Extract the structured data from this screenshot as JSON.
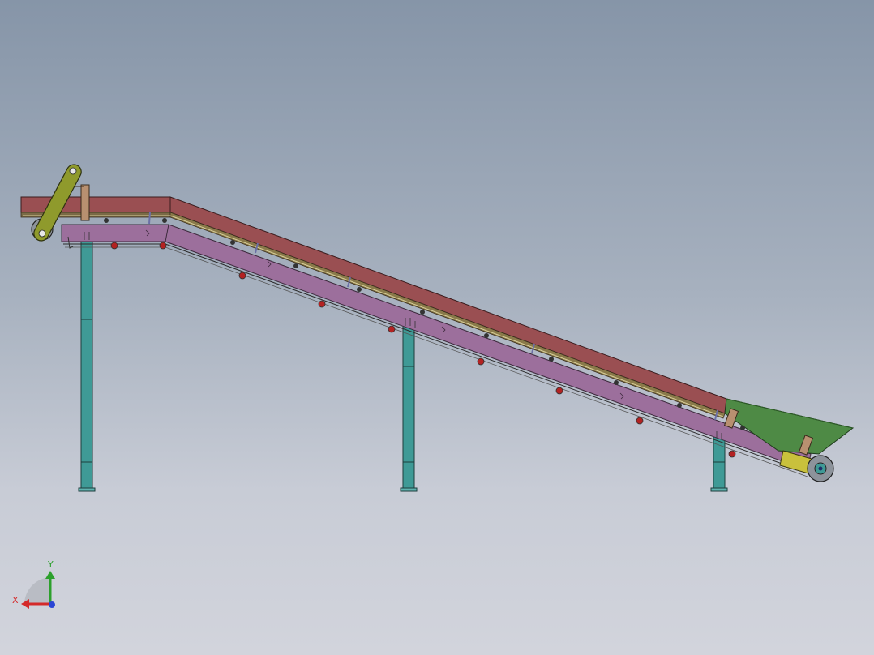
{
  "viewport": {
    "background_top": "#8695a8",
    "background_bottom": "#d2d4dc"
  },
  "model": {
    "belt_color": "#9a4f52",
    "frame_color": "#9c6f9c",
    "leg_color": "#3f9a96",
    "hopper_color": "#4e8a45",
    "drive_arm_color": "#8f9a2c",
    "roller_color": "#b32222"
  },
  "triad": {
    "x_label": "X",
    "y_label": "Y",
    "x_color": "#d42a2a",
    "y_color": "#2ca02c",
    "z_color": "#2a45d4"
  }
}
